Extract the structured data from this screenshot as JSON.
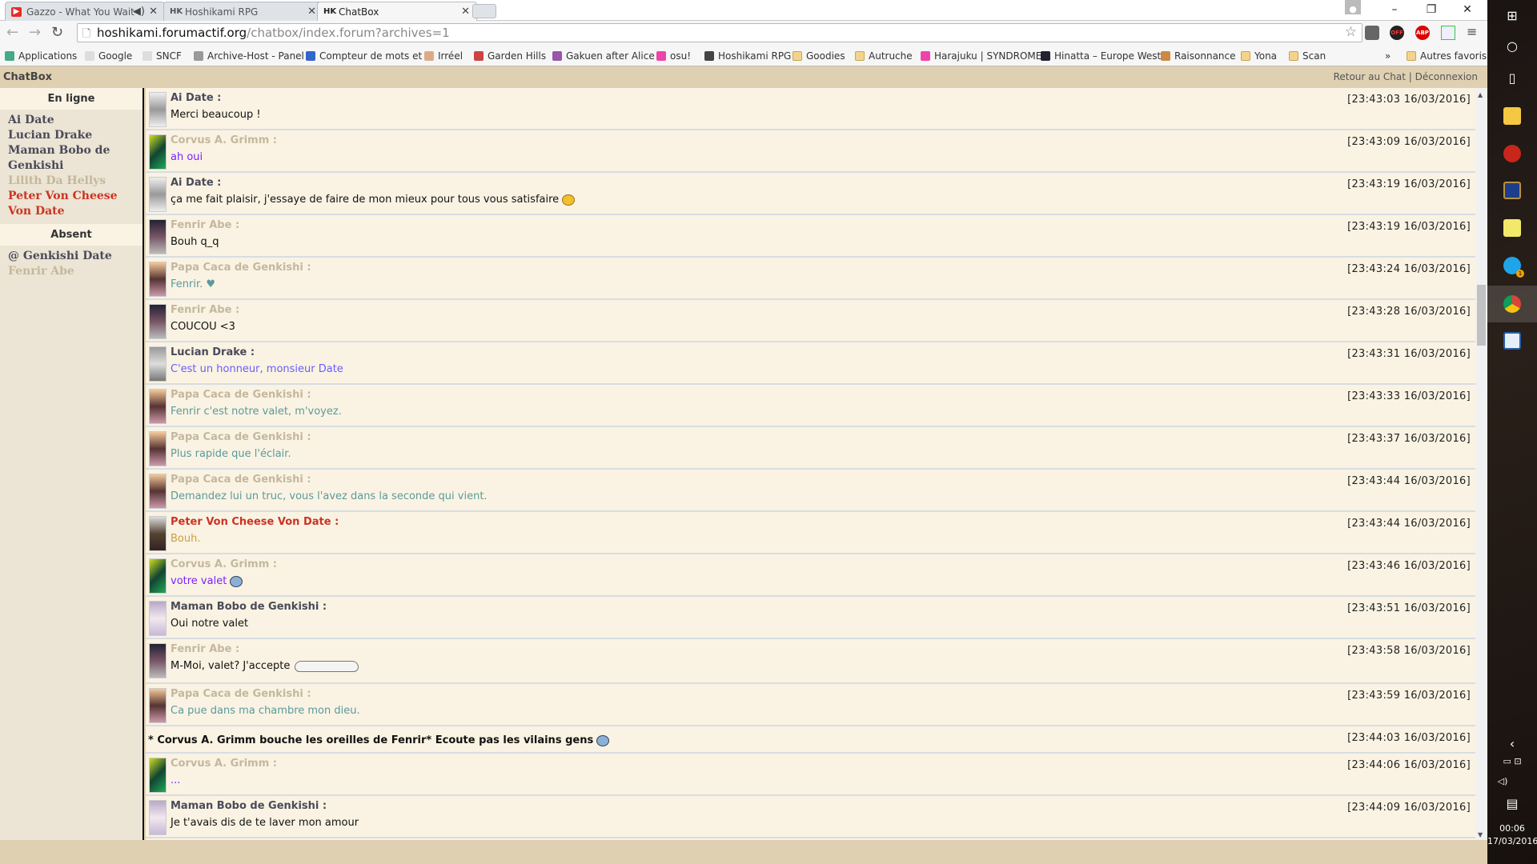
{
  "browser": {
    "tabs": [
      {
        "title": "Gazzo - What You Wait",
        "icon": "youtube-icon",
        "audio": true
      },
      {
        "title": "Hoshikami RPG",
        "icon": "hk-icon"
      },
      {
        "title": "ChatBox",
        "icon": "hk-icon",
        "active": true
      }
    ],
    "url_host": "hoshikami.forumactif.org",
    "url_path": "/chatbox/index.forum?archives=1",
    "bookmarks": [
      "Applications",
      "Google",
      "SNCF",
      "Archive-Host - Panel",
      "Compteur de mots et",
      "Irréel",
      "Garden Hills",
      "Gakuen after Alice",
      "osu!",
      "Hoshikami RPG",
      "Goodies",
      "Autruche",
      "Harajuku | SYNDROME",
      "Hinatta – Europe West",
      "Raisonnance",
      "Yona",
      "Scan"
    ],
    "more": "»",
    "other_bookmarks": "Autres favoris",
    "extensions": {
      "off": "OFF",
      "abp": "ABP"
    }
  },
  "chatbox": {
    "title": "ChatBox",
    "link_back": "Retour au Chat",
    "separator": "|",
    "link_logout": "Déconnexion",
    "online_heading": "En ligne",
    "online": [
      {
        "name": "Ai Date",
        "color": "#4a4a5a"
      },
      {
        "name": "Lucian Drake",
        "color": "#4a4a5a"
      },
      {
        "name": "Maman Bobo de Genkishi",
        "color": "#4a4a5a"
      },
      {
        "name": "Lilith Da Hellys",
        "color": "#c4b89c"
      },
      {
        "name": "Peter Von Cheese Von Date",
        "color": "#cc3322"
      }
    ],
    "absent_heading": "Absent",
    "absent": [
      {
        "name": "@ Genkishi Date",
        "color": "#4a4a5a"
      },
      {
        "name": "Fenrir Abe",
        "color": "#c4b89c"
      }
    ],
    "messages": [
      {
        "author": "Ai Date :",
        "text": "Merci beaucoup !",
        "time": "[23:43:03 16/03/2016]",
        "name_color": "#4a4a5a",
        "text_color": "#111111"
      },
      {
        "author": "Corvus A. Grimm :",
        "text": "ah oui",
        "time": "[23:43:09 16/03/2016]",
        "name_color": "#c4b89c",
        "text_color": "#7a22ff"
      },
      {
        "author": "Ai Date :",
        "text": "ça me fait plaisir, j'essaye de faire de mon mieux pour tous vous satisfaire",
        "time": "[23:43:19 16/03/2016]",
        "name_color": "#4a4a5a",
        "text_color": "#111111",
        "emoji": "yellow"
      },
      {
        "author": "Fenrir Abe :",
        "text": "Bouh q_q",
        "time": "[23:43:19 16/03/2016]",
        "name_color": "#c4b89c",
        "text_color": "#111111"
      },
      {
        "author": "Papa Caca de Genkishi :",
        "text": "Fenrir. ♥",
        "time": "[23:43:24 16/03/2016]",
        "name_color": "#c4b89c",
        "text_color": "#5a9a9c"
      },
      {
        "author": "Fenrir Abe :",
        "text": "COUCOU <3",
        "time": "[23:43:28 16/03/2016]",
        "name_color": "#c4b89c",
        "text_color": "#111111"
      },
      {
        "author": "Lucian Drake :",
        "text": "C'est un honneur, monsieur Date",
        "time": "[23:43:31 16/03/2016]",
        "name_color": "#4a4a5a",
        "text_color": "#6a5cff"
      },
      {
        "author": "Papa Caca de Genkishi :",
        "text": "Fenrir c'est notre valet, m'voyez.",
        "time": "[23:43:33 16/03/2016]",
        "name_color": "#c4b89c",
        "text_color": "#5a9a9c"
      },
      {
        "author": "Papa Caca de Genkishi :",
        "text": "Plus rapide que l'éclair.",
        "time": "[23:43:37 16/03/2016]",
        "name_color": "#c4b89c",
        "text_color": "#5a9a9c"
      },
      {
        "author": "Papa Caca de Genkishi :",
        "text": "Demandez lui un truc, vous l'avez dans la seconde qui vient.",
        "time": "[23:43:44 16/03/2016]",
        "name_color": "#c4b89c",
        "text_color": "#5a9a9c"
      },
      {
        "author": "Peter Von Cheese Von Date :",
        "text": "Bouh.",
        "time": "[23:43:44 16/03/2016]",
        "name_color": "#cc3322",
        "text_color": "#c8a040"
      },
      {
        "author": "Corvus A. Grimm :",
        "text": "votre valet",
        "time": "[23:43:46 16/03/2016]",
        "name_color": "#c4b89c",
        "text_color": "#7a22ff",
        "emoji": "blue"
      },
      {
        "author": "Maman Bobo de Genkishi :",
        "text": "Oui notre valet",
        "time": "[23:43:51 16/03/2016]",
        "name_color": "#4a4a5a",
        "text_color": "#111111"
      },
      {
        "author": "Fenrir Abe :",
        "text": "M-Moi, valet? J'accepte",
        "time": "[23:43:58 16/03/2016]",
        "name_color": "#c4b89c",
        "text_color": "#111111",
        "emoji": "bunny"
      },
      {
        "author": "Papa Caca de Genkishi :",
        "text": "Ca pue dans ma chambre mon dieu.",
        "time": "[23:43:59 16/03/2016]",
        "name_color": "#c4b89c",
        "text_color": "#5a9a9c"
      },
      {
        "action": true,
        "text": "* Corvus A. Grimm bouche les oreilles de Fenrir*  Ecoute pas les vilains gens",
        "time": "[23:44:03 16/03/2016]",
        "emoji": "blue"
      },
      {
        "author": "Corvus A. Grimm :",
        "text": "...",
        "time": "[23:44:06 16/03/2016]",
        "name_color": "#c4b89c",
        "text_color": "#7a22ff"
      },
      {
        "author": "Maman Bobo de Genkishi :",
        "text": "Je t'avais dis de te laver mon amour",
        "time": "[23:44:09 16/03/2016]",
        "name_color": "#4a4a5a",
        "text_color": "#111111"
      }
    ]
  },
  "taskbar": {
    "clock_time": "00:06",
    "clock_date": "17/03/2016",
    "skype_badge": "1"
  }
}
